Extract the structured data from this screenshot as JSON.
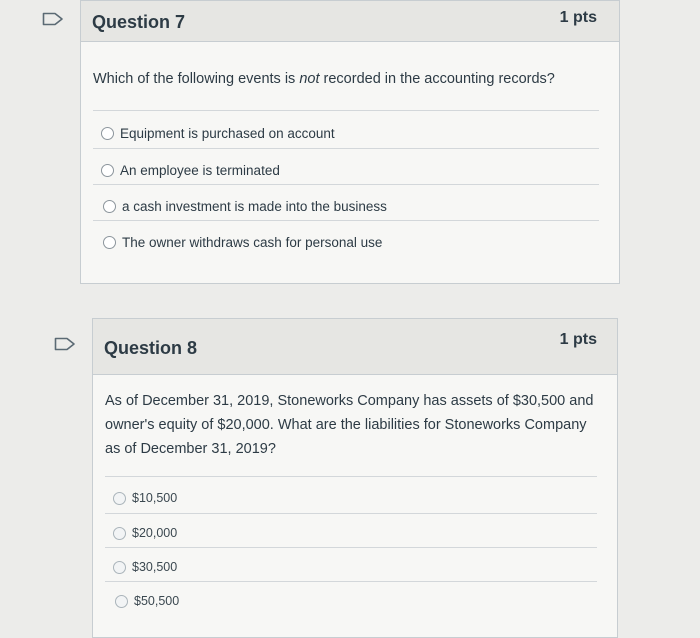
{
  "questions": [
    {
      "title": "Question 7",
      "points": "1 pts",
      "text_before": "Which of the following events is ",
      "text_emphasis": "not",
      "text_after": " recorded in the accounting records?",
      "answers": [
        "Equipment is purchased on account",
        "An employee is terminated",
        "a cash investment is made into the business",
        "The owner withdraws cash for personal use"
      ]
    },
    {
      "title": "Question 8",
      "points": "1 pts",
      "text": "As of December 31, 2019, Stoneworks Company has assets of $30,500 and owner's equity of $20,000. What are the liabilities for Stoneworks Company as of December 31, 2019?",
      "answers": [
        "$10,500",
        "$20,000",
        "$30,500",
        "$50,500"
      ]
    }
  ],
  "colors": {
    "background": "#ececea",
    "card": "#f7f7f5",
    "header": "#e6e6e3",
    "text": "#2d3b45"
  },
  "icons": {
    "flag": "flag-question-icon"
  }
}
